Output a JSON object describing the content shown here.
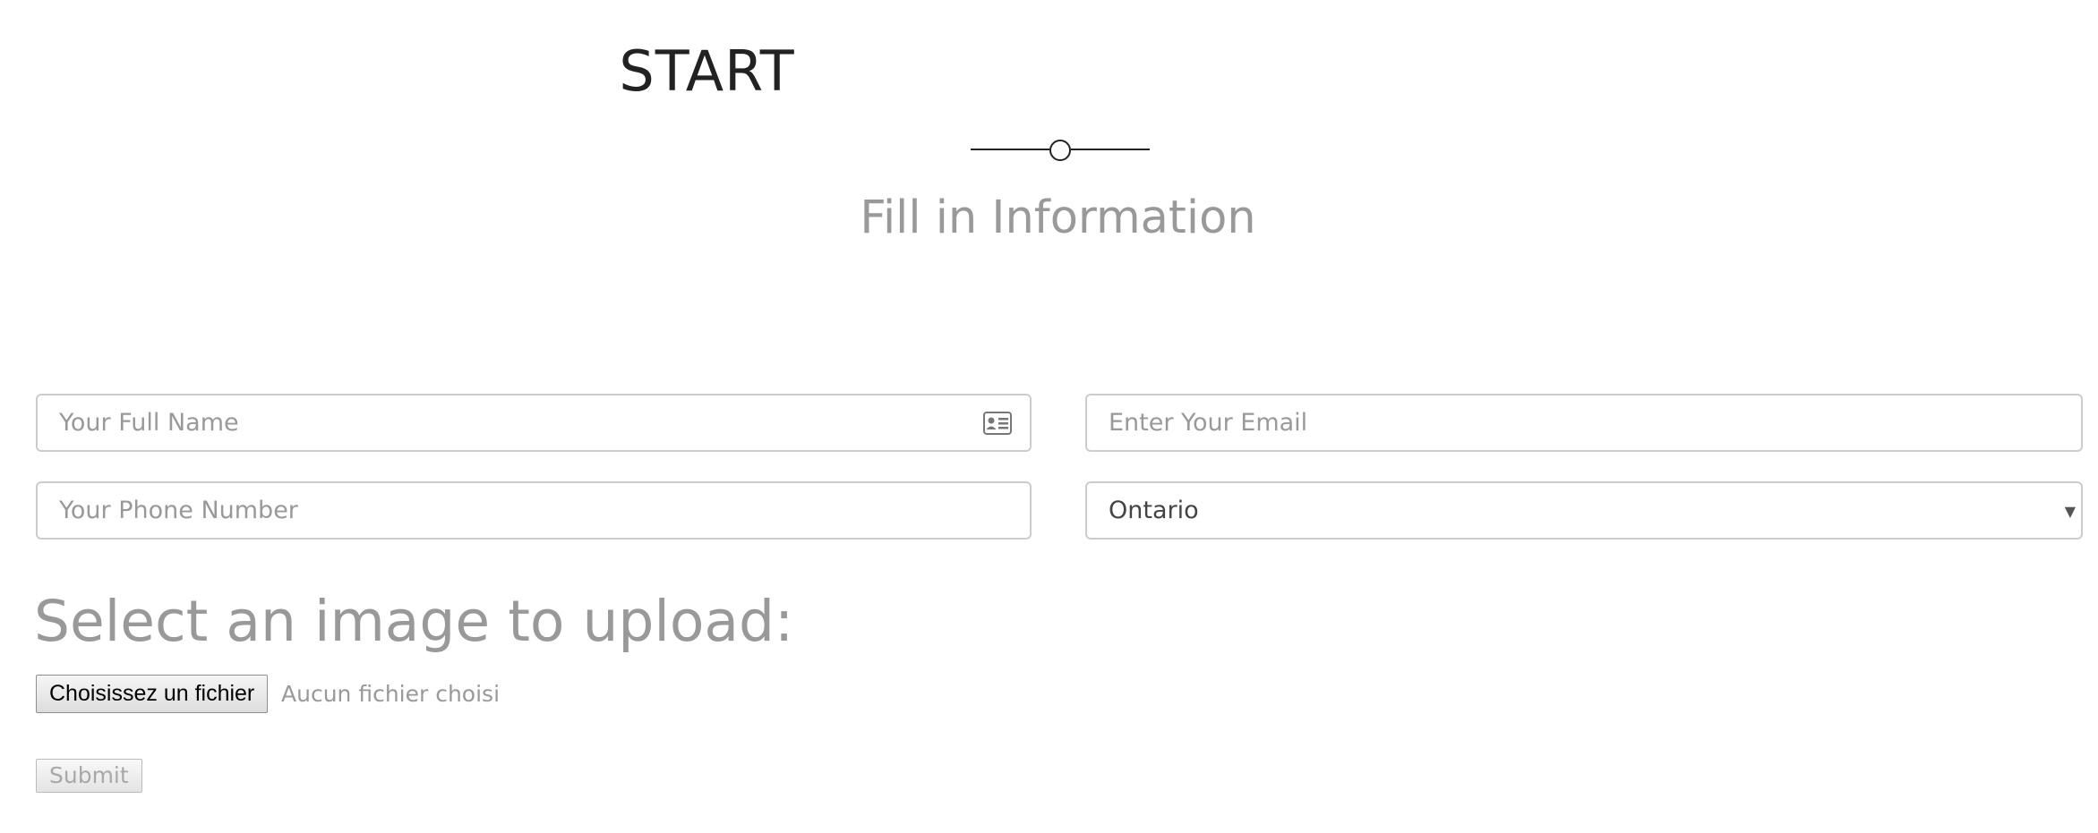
{
  "header": {
    "title": "START",
    "subtitle": "Fill in Information"
  },
  "form": {
    "full_name": {
      "placeholder": "Your Full Name",
      "value": "",
      "icon": "id-card-icon"
    },
    "email": {
      "placeholder": "Enter Your Email",
      "value": ""
    },
    "phone": {
      "placeholder": "Your Phone Number",
      "value": ""
    },
    "region": {
      "selected": "Ontario",
      "icon": "chevron-down-icon"
    }
  },
  "upload": {
    "heading": "Select an image to upload:",
    "button_label": "Choisissez un fichier",
    "status": "Aucun fichier choisi"
  },
  "submit": {
    "label": "Submit"
  }
}
